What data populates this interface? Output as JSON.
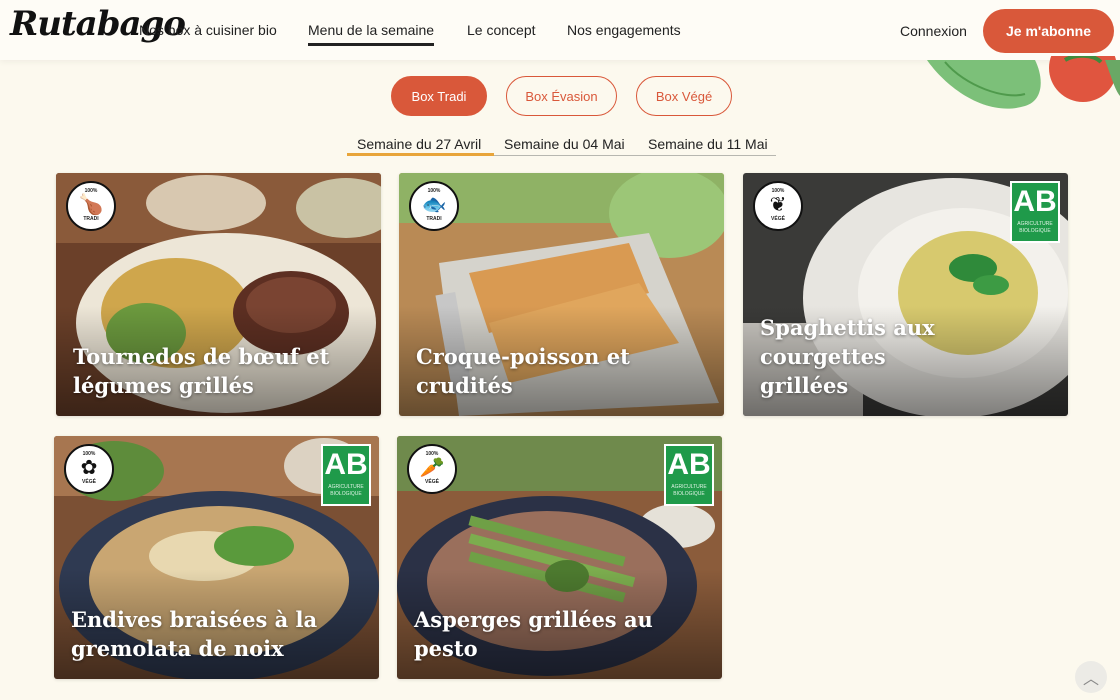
{
  "header": {
    "logo": "Rutabago",
    "nav": [
      {
        "label": "Nos box à cuisiner bio"
      },
      {
        "label": "Menu de la semaine"
      },
      {
        "label": "Le concept"
      },
      {
        "label": "Nos engagements"
      }
    ],
    "login_label": "Connexion",
    "subscribe_label": "Je m'abonne"
  },
  "box_tabs": [
    {
      "label": "Box Tradi"
    },
    {
      "label": "Box Évasion"
    },
    {
      "label": "Box Végé"
    }
  ],
  "weeks": [
    {
      "label": "Semaine du 27 Avril"
    },
    {
      "label": "Semaine du 04 Mai"
    },
    {
      "label": "Semaine du 11 Mai"
    }
  ],
  "recipes": [
    {
      "title_line1": "Tournedos de bœuf et",
      "title_line2": "légumes grillés",
      "badge_top": "100%",
      "badge_bottom": "TRADI",
      "badge_icon": "chicken-leg-icon"
    },
    {
      "title_line1": "Croque-poisson et crudités",
      "title_line2": "",
      "badge_top": "100%",
      "badge_bottom": "TRADI",
      "badge_icon": "fish-icon"
    },
    {
      "title_line1": "Spaghettis aux courgettes",
      "title_line2": "grillées",
      "badge_top": "100%",
      "badge_bottom": "VÉGÉ",
      "badge_icon": "artichoke-icon",
      "organic": "AB"
    },
    {
      "title_line1": "Endives braisées à la",
      "title_line2": "gremolata de noix",
      "badge_top": "100%",
      "badge_bottom": "VÉGÉ",
      "badge_icon": "cauliflower-icon",
      "organic": "AB"
    },
    {
      "title_line1": "Asperges grillées au pesto",
      "title_line2": "",
      "badge_top": "100%",
      "badge_bottom": "VÉGÉ",
      "badge_icon": "carrot-icon",
      "organic": "AB"
    }
  ],
  "organic_label": {
    "letters": "AB",
    "subtitle": "AGRICULTURE BIOLOGIQUE"
  },
  "colors": {
    "accent": "#d9583a",
    "week_underline": "#e8a53a",
    "background": "#fcf9ee",
    "organic_green": "#1f9a4a"
  }
}
